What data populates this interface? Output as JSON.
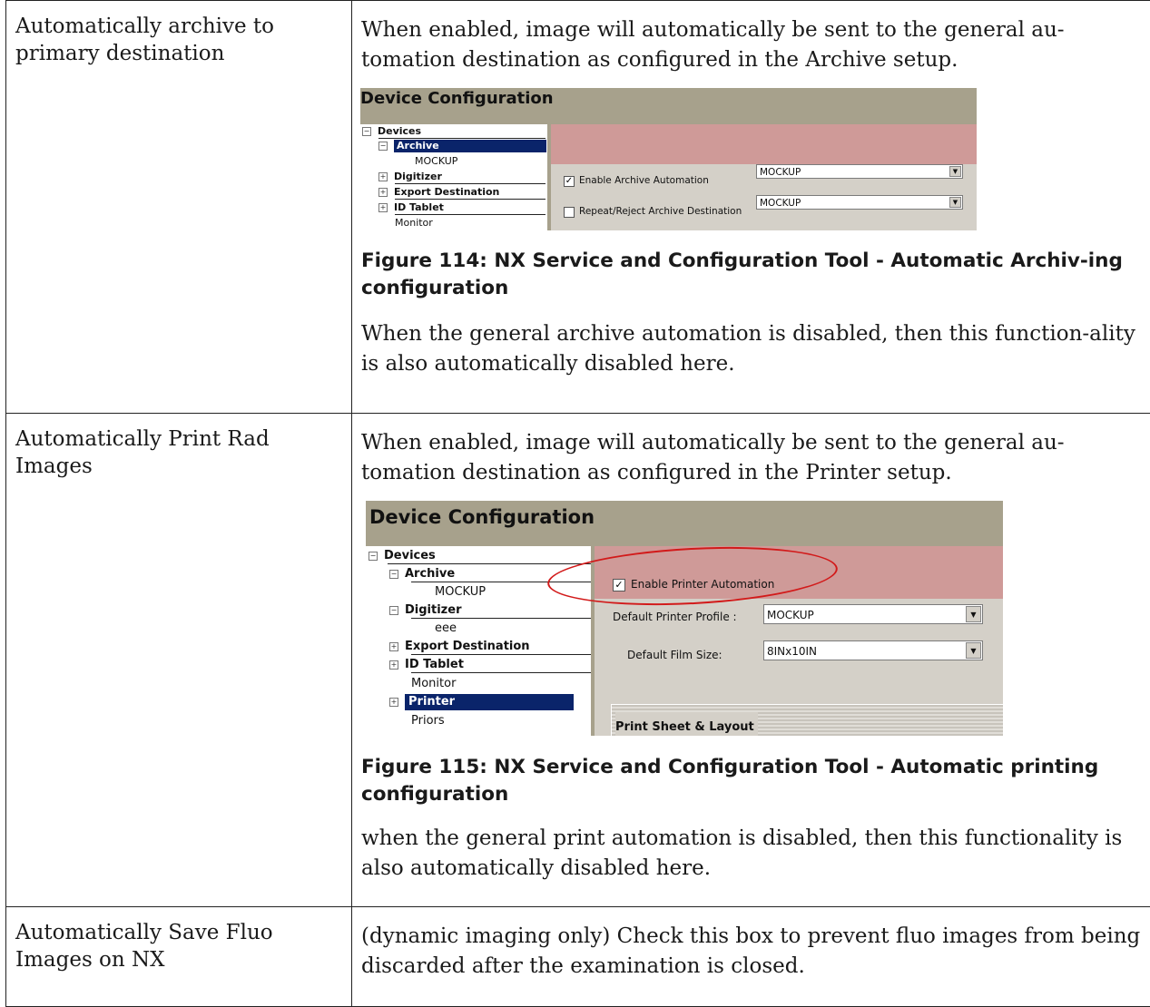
{
  "rows": [
    {
      "label": "Automatically archive to primary destination",
      "intro": "When enabled, image will automatically be sent to the general au-tomation destination as configured in the Archive setup.",
      "screenshot": {
        "title": "Device Configuration",
        "tree": [
          "Devices",
          "Archive",
          "MOCKUP",
          "Digitizer",
          "Export Destination",
          "ID Tablet",
          "Monitor"
        ],
        "options": [
          {
            "label": "Enable Archive Automation",
            "checked": true,
            "value": "MOCKUP"
          },
          {
            "label": "Repeat/Reject Archive Destination",
            "checked": false,
            "value": "MOCKUP"
          }
        ]
      },
      "caption": "Figure 114: NX Service and Configuration Tool - Automatic Archiv-ing configuration",
      "note": "When the general archive automation is disabled, then this function-ality is also automatically disabled here."
    },
    {
      "label": "Automatically Print Rad Images",
      "intro": "When enabled, image will automatically be sent to the general au-tomation destination as configured in the Printer setup.",
      "screenshot": {
        "title": "Device Configuration",
        "tree": [
          "Devices",
          "Archive",
          "MOCKUP",
          "Digitizer",
          "eee",
          "Export Destination",
          "ID Tablet",
          "Monitor",
          "Printer",
          "Priors"
        ],
        "enable_label": "Enable Printer Automation",
        "profile_label": "Default Printer Profile :",
        "profile_value": "MOCKUP",
        "film_label": "Default Film Size:",
        "film_value": "8INx10IN",
        "section": "Print Sheet & Layout"
      },
      "caption": "Figure 115: NX Service and Configuration Tool - Automatic printing configuration",
      "note": "when the general print automation is disabled, then this functionality is also automatically disabled here."
    },
    {
      "label": "Automatically Save Fluo Images on NX",
      "intro": "(dynamic imaging only) Check this box to prevent fluo images from being discarded after the examination is closed."
    }
  ],
  "colors": {
    "highlight_pink": "#cf9a98",
    "title_bar": "#a7a18c",
    "selection": "#0a246a",
    "annotation_red": "#d21a1a"
  },
  "icons": [
    "checkbox-checked-icon",
    "checkbox-unchecked-icon",
    "tree-expand-icon",
    "tree-collapse-icon",
    "dropdown-arrow-icon"
  ]
}
